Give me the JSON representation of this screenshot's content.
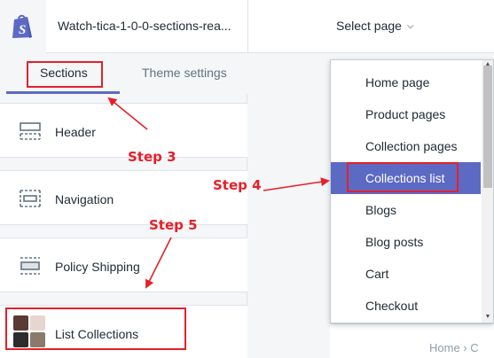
{
  "header": {
    "theme_title": "Watch-tica-1-0-0-sections-rea...",
    "select_page_label": "Select page"
  },
  "sidebar": {
    "tabs": [
      {
        "label": "Sections"
      },
      {
        "label": "Theme settings"
      }
    ],
    "sections": [
      {
        "label": "Header",
        "icon": "header-layout-icon"
      },
      {
        "label": "Navigation",
        "icon": "navigation-layout-icon"
      },
      {
        "label": "Policy Shipping",
        "icon": "policy-layout-icon"
      },
      {
        "label": "List Collections",
        "icon": "collection-thumbnails-icon"
      }
    ]
  },
  "dropdown": {
    "items": [
      {
        "label": "Home page"
      },
      {
        "label": "Product pages"
      },
      {
        "label": "Collection pages"
      },
      {
        "label": "Collections list"
      },
      {
        "label": "Blogs"
      },
      {
        "label": "Blog posts"
      },
      {
        "label": "Cart"
      },
      {
        "label": "Checkout"
      }
    ],
    "active_item": "Collections list"
  },
  "preview": {
    "breadcrumb": "Home  ›  C"
  },
  "annotations": {
    "steps": [
      "Step 3",
      "Step 4",
      "Step 5"
    ]
  },
  "colors": {
    "accent": "#5c6ac4",
    "annotation_red": "#e5202a",
    "shopify_green": "#5c6ac4"
  }
}
